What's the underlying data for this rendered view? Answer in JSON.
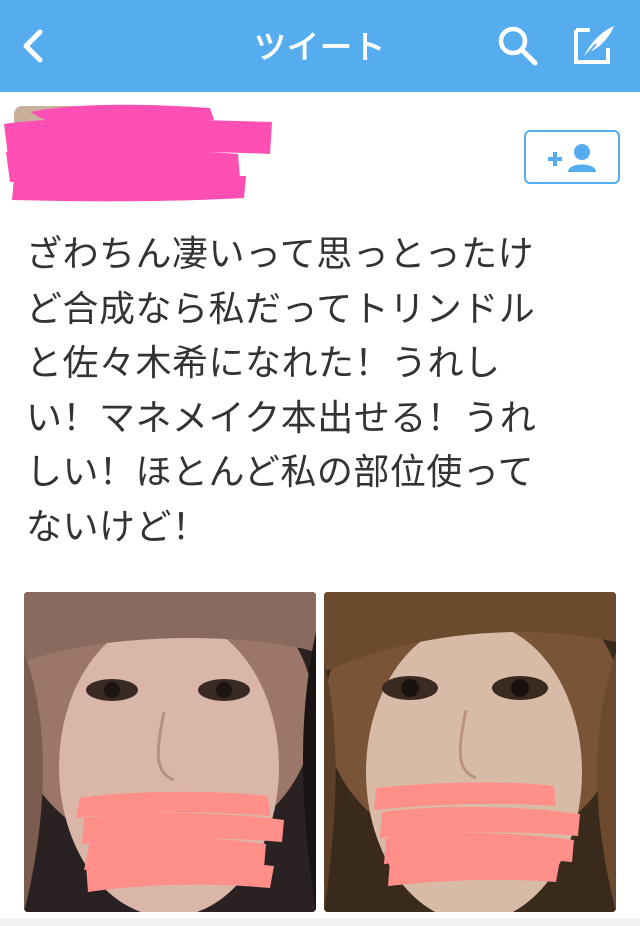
{
  "navbar": {
    "title": "ツイート",
    "back_icon": "chevron-left-icon",
    "search_icon": "search-icon",
    "compose_icon": "compose-icon",
    "background": "#55acee"
  },
  "tweet": {
    "text_lines": [
      "ざわちん凄いって思っとったけ",
      "ど合成なら私だってトリンドル",
      "と佐々木希になれた！うれし",
      "い！マネメイク本出せる！うれ",
      "しい！ほとんど私の部位使って",
      "ないけど！"
    ]
  },
  "follow_button": {
    "icon": "add-user-icon",
    "color": "#55acee"
  },
  "redaction_color": "#ff4fb5",
  "photo_redaction_color": "#ff8f88"
}
